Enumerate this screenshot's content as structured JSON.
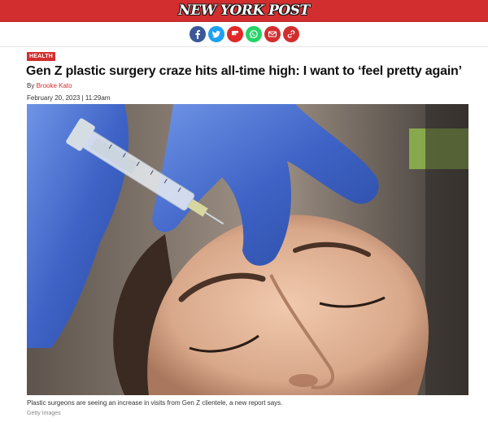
{
  "masthead": {
    "logo_text": "NEW YORK POST"
  },
  "share": {
    "buttons": [
      {
        "name": "facebook",
        "icon": "facebook-icon",
        "color": "#3b5998"
      },
      {
        "name": "twitter",
        "icon": "twitter-icon",
        "color": "#1da1f2"
      },
      {
        "name": "flipboard",
        "icon": "flipboard-icon",
        "color": "#e12828"
      },
      {
        "name": "whatsapp",
        "icon": "whatsapp-icon",
        "color": "#25d366"
      },
      {
        "name": "email",
        "icon": "email-icon",
        "color": "#d22e2f"
      },
      {
        "name": "link",
        "icon": "link-icon",
        "color": "#d22e2f"
      }
    ]
  },
  "article": {
    "section_tag": "HEALTH",
    "headline": "Gen Z plastic surgery craze hits all-time high: I want to ‘feel pretty again’",
    "byline_prefix": "By ",
    "author": "Brooke Kato",
    "date": "February 20, 2023 | 11:29am",
    "image": {
      "description_icon": "injection-photo",
      "caption": "Plastic surgeons are seeing an increase in visits from Gen Z clientele, a new report says.",
      "credit": "Getty Images"
    }
  },
  "colors": {
    "brand_red": "#d22e2f"
  }
}
